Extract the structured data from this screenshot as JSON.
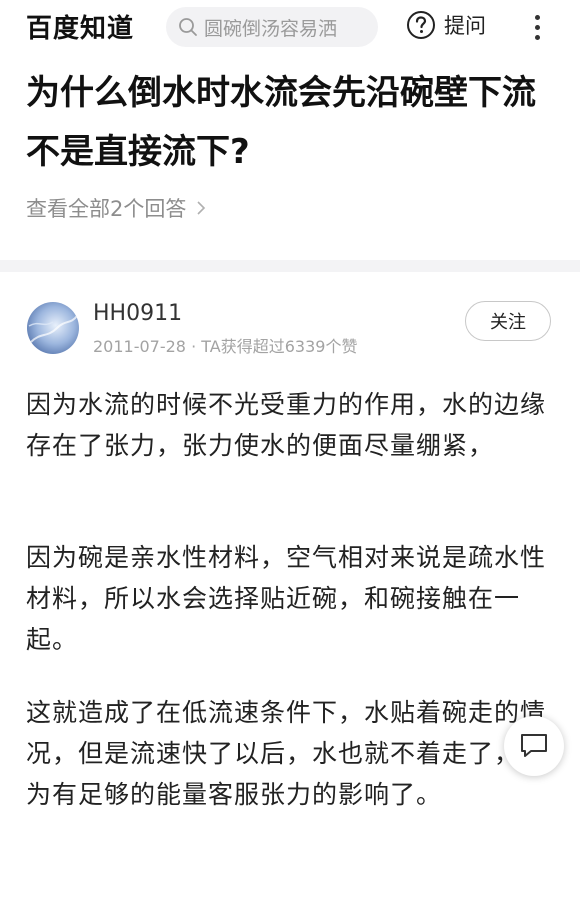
{
  "header": {
    "logo": "百度知道",
    "search_placeholder": "圆碗倒汤容易洒",
    "ask_label": "提问"
  },
  "question": {
    "title": "为什么倒水时水流会先沿碗壁下流不是直接流下?",
    "view_all": "查看全部2个回答"
  },
  "answer": {
    "username": "HH0911",
    "date": "2011-07-28",
    "separator": "·",
    "likes_text": "TA获得超过6339个赞",
    "follow_label": "关注",
    "paragraphs": [
      "因为水流的时候不光受重力的作用，水的边缘存在了张力，张力使水的便面尽量绷紧，",
      "因为碗是亲水性材料，空气相对来说是疏水性材料，所以水会选择贴近碗，和碗接触在一起。",
      "这就造成了在低流速条件下，水贴着碗走的情况，但是流速快了以后，水也就不着走了，因为有足够的能量客服张力的影响了。"
    ]
  },
  "colors": {
    "text": "#222222",
    "muted": "#8d8d8d",
    "divider": "#f3f3f5",
    "search_bg": "#f2f2f4"
  }
}
